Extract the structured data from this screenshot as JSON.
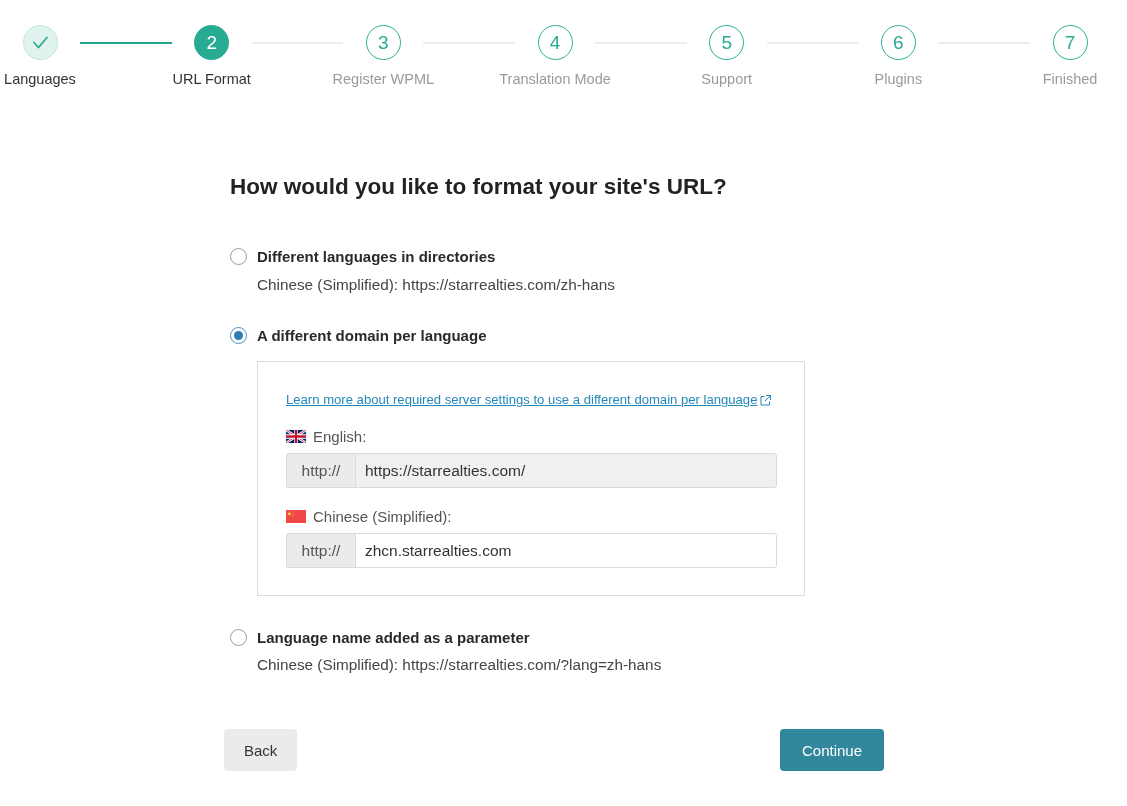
{
  "stepper": {
    "steps": [
      {
        "label": "Languages",
        "completed": true,
        "selected": false
      },
      {
        "number": "2",
        "label": "URL Format",
        "completed": false,
        "selected": true
      },
      {
        "number": "3",
        "label": "Register WPML",
        "completed": false,
        "selected": false
      },
      {
        "number": "4",
        "label": "Translation Mode",
        "completed": false,
        "selected": false
      },
      {
        "number": "5",
        "label": "Support",
        "completed": false,
        "selected": false
      },
      {
        "number": "6",
        "label": "Plugins",
        "completed": false,
        "selected": false
      },
      {
        "number": "7",
        "label": "Finished",
        "completed": false,
        "selected": false
      }
    ]
  },
  "heading": "How would you like to format your site's URL?",
  "options": [
    {
      "label": "Different languages in directories",
      "selected": false,
      "description": "Chinese (Simplified): https://starrealties.com/zh-hans"
    },
    {
      "label": "A different domain per language",
      "selected": true,
      "panel": {
        "link": "Learn more about required server settings to use a different domain per language",
        "domains": [
          {
            "kind": "uk",
            "language": "English:",
            "prefix": "http://",
            "value": "https://starrealties.com/",
            "disabled": true
          },
          {
            "kind": "china",
            "language": "Chinese (Simplified):",
            "prefix": "http://",
            "value": "zhcn.starrealties.com",
            "disabled": false
          }
        ]
      }
    },
    {
      "label": "Language name added as a parameter",
      "selected": false,
      "description": "Chinese (Simplified): https://starrealties.com/?lang=zh-hans"
    }
  ],
  "buttons": [
    {
      "label": "Back",
      "kind": "secondary"
    },
    {
      "label": "Continue",
      "kind": "primary"
    }
  ]
}
